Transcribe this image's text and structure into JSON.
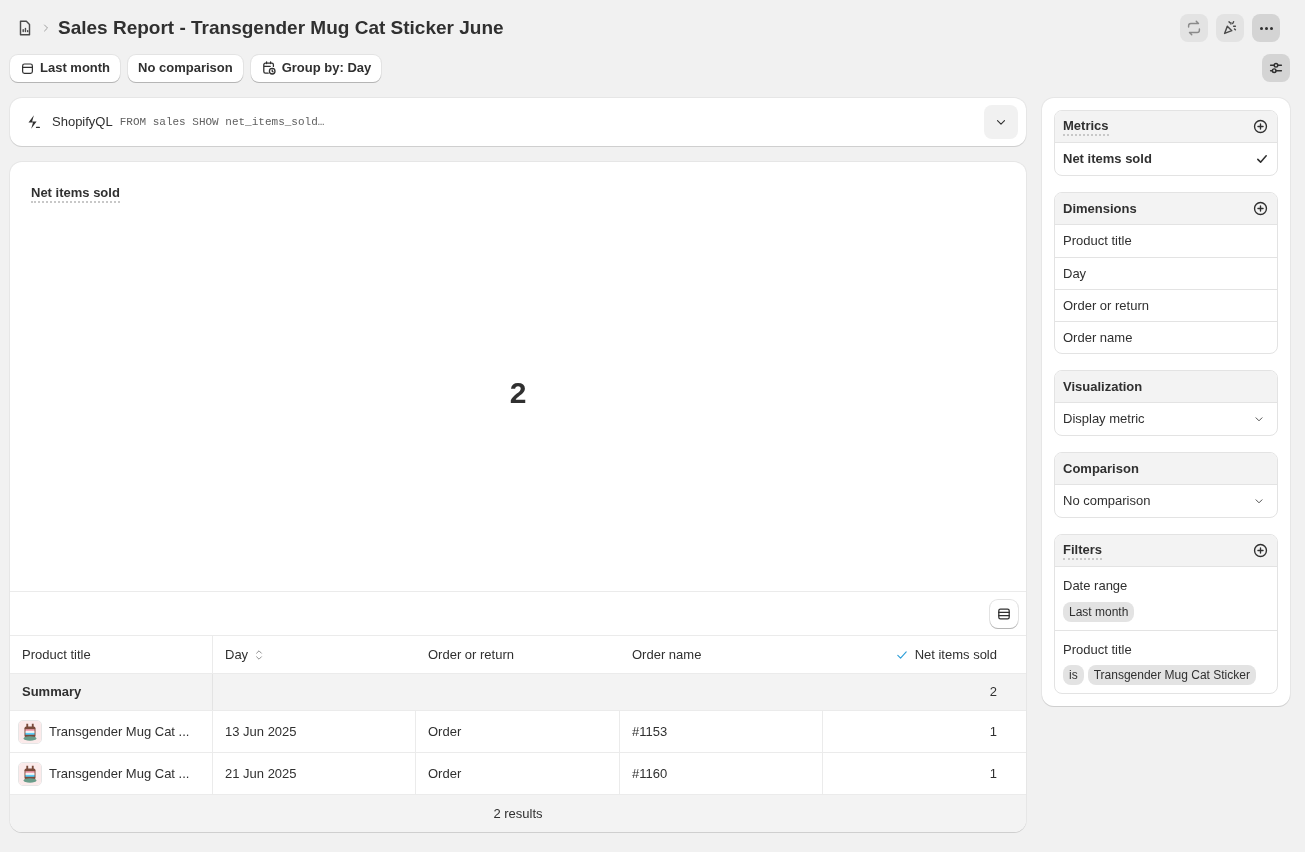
{
  "header": {
    "title": "Sales Report - Transgender Mug Cat Sticker June",
    "panel_toggle": {
      "selected": true
    }
  },
  "toolbar": [
    {
      "kind": "date",
      "label": "Last month"
    },
    {
      "kind": "plain",
      "label": "No comparison"
    },
    {
      "kind": "group",
      "label": "Group by: Day"
    }
  ],
  "query": {
    "label": "ShopifyQL",
    "code": "FROM sales SHOW net_items_sold…"
  },
  "metric_card": {
    "title": "Net items sold",
    "value": "2"
  },
  "table": {
    "columns": [
      {
        "kind": "plain",
        "label": "Product title"
      },
      {
        "kind": "sortable",
        "label": "Day"
      },
      {
        "kind": "plain",
        "label": "Order or return"
      },
      {
        "kind": "plain",
        "label": "Order name"
      },
      {
        "kind": "checked",
        "label": "Net items sold"
      }
    ],
    "summary": {
      "label": "Summary",
      "total": "2"
    },
    "rows": [
      {
        "cells": [
          "Transgender Mug Cat ...",
          "13 Jun 2025",
          "Order",
          "#1153",
          "1"
        ]
      },
      {
        "cells": [
          "Transgender Mug Cat ...",
          "21 Jun 2025",
          "Order",
          "#1160",
          "1"
        ]
      }
    ],
    "footer": "2 results"
  },
  "sidebar": [
    {
      "title": "Metrics",
      "dotted": true,
      "addable": true,
      "items": [
        {
          "kind": "check",
          "label": "Net items sold",
          "checked": true
        }
      ]
    },
    {
      "title": "Dimensions",
      "dotted": false,
      "addable": true,
      "items": [
        {
          "kind": "plain",
          "label": "Product title"
        },
        {
          "kind": "plain",
          "label": "Day"
        },
        {
          "kind": "plain",
          "label": "Order or return"
        },
        {
          "kind": "plain",
          "label": "Order name"
        }
      ]
    },
    {
      "title": "Visualization",
      "dotted": false,
      "addable": false,
      "items": [
        {
          "kind": "select",
          "label": "Display metric"
        }
      ]
    },
    {
      "title": "Comparison",
      "dotted": false,
      "addable": false,
      "items": [
        {
          "kind": "select",
          "label": "No comparison"
        }
      ]
    },
    {
      "title": "Filters",
      "dotted": true,
      "addable": true,
      "items": [
        {
          "kind": "filter",
          "label": "Date range",
          "chips": [
            "Last month"
          ]
        },
        {
          "kind": "filter",
          "label": "Product title",
          "chips": [
            "is",
            "Transgender Mug Cat Sticker"
          ]
        }
      ]
    }
  ]
}
